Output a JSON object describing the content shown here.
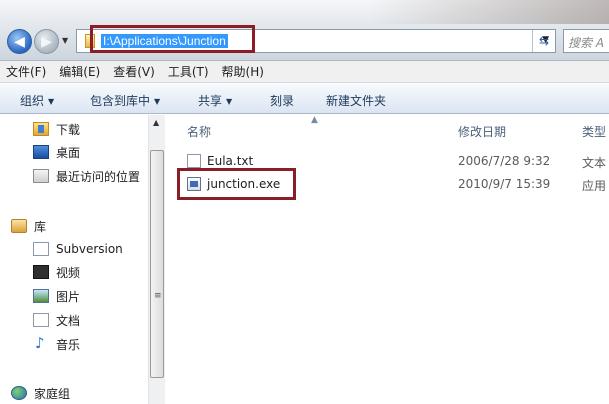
{
  "address": {
    "path": "I:\\Applications\\Junction",
    "search_placeholder": "搜索 A"
  },
  "menubar": [
    "文件(F)",
    "编辑(E)",
    "查看(V)",
    "工具(T)",
    "帮助(H)"
  ],
  "toolbar": {
    "organize": "组织",
    "include_library": "包含到库中",
    "share": "共享",
    "burn": "刻录",
    "new_folder": "新建文件夹"
  },
  "nav": {
    "downloads": "下载",
    "desktop": "桌面",
    "recent": "最近访问的位置",
    "libraries": "库",
    "subversion": "Subversion",
    "videos": "视频",
    "pictures": "图片",
    "documents": "文档",
    "music": "音乐",
    "homegroup": "家庭组"
  },
  "columns": {
    "name": "名称",
    "date": "修改日期",
    "type": "类型"
  },
  "files": [
    {
      "name": "Eula.txt",
      "date": "2006/7/28 9:32",
      "type": "文本"
    },
    {
      "name": "junction.exe",
      "date": "2010/9/7 15:39",
      "type": "应用"
    }
  ],
  "colors": {
    "highlight_border": "#8c1c25",
    "selection_bg": "#3399ff"
  }
}
